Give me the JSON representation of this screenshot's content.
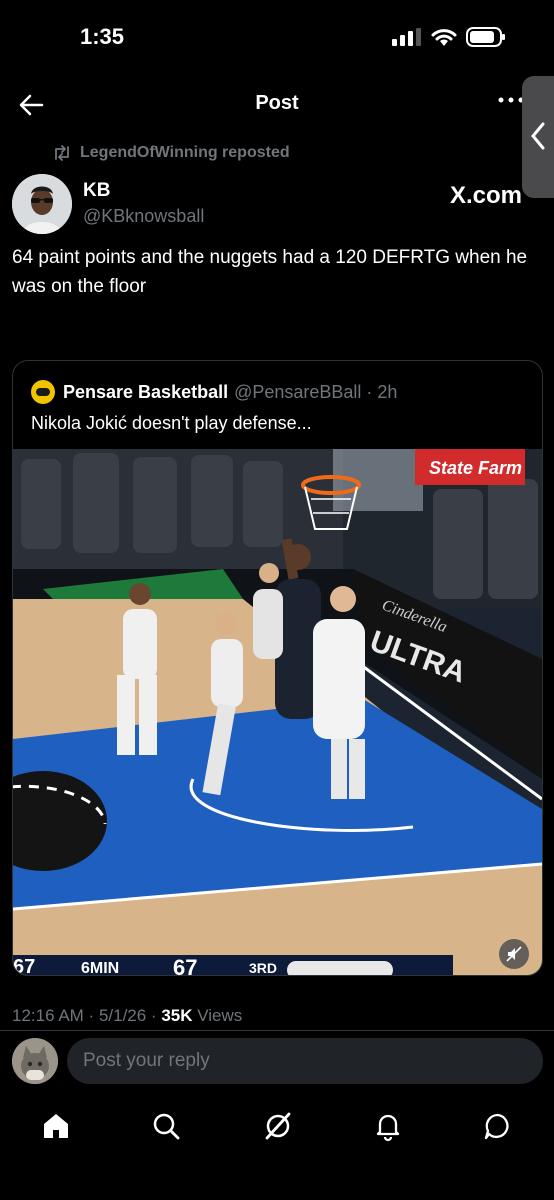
{
  "status_bar": {
    "time": "1:35"
  },
  "header": {
    "title": "Post"
  },
  "repost": {
    "text": "LegendOfWinning reposted"
  },
  "author": {
    "name": "KB",
    "handle": "@KBknowsball",
    "badge": "X.com"
  },
  "post": {
    "text": "64 paint points and the nuggets had a 120 DEFRTG when he was on the floor"
  },
  "quoted": {
    "name": "Pensare Basketball",
    "handle": "@PensareBBall · 2h",
    "text": "Nikola Jokić doesn't play defense...",
    "video_overlay": {
      "sponsor": "State Farm",
      "court_text": "ULTRA",
      "court_script": "Cinderella",
      "score_left": "67",
      "clock_label": "6MIN",
      "score_right": "67",
      "period": "3RD"
    }
  },
  "meta": {
    "time": "12:16 AM",
    "date": "5/1/26",
    "views_count": "35K",
    "views_label": "Views"
  },
  "reply": {
    "placeholder": "Post your reply"
  },
  "nav": [
    "home-icon",
    "search-icon",
    "grok-icon",
    "notifications-icon",
    "messages-icon"
  ],
  "colors": {
    "background": "#000000",
    "muted": "#71767b",
    "text": "#e7e9ea",
    "input_bg": "#202327",
    "court_blue": "#1f5fc0"
  }
}
